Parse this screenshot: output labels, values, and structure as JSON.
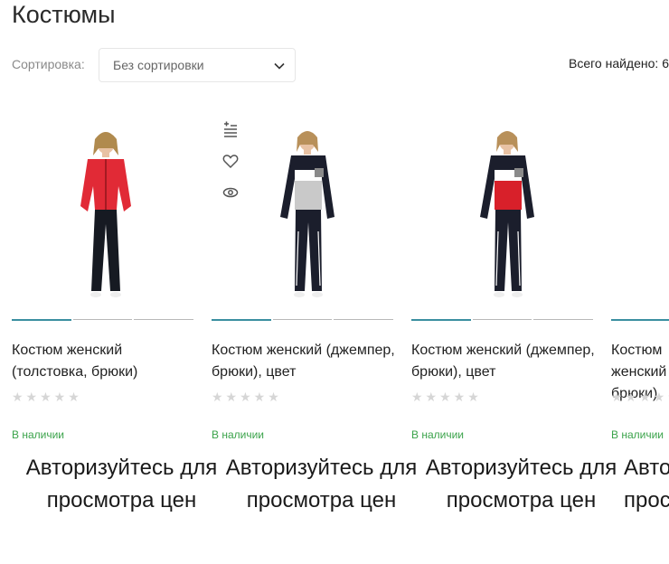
{
  "page": {
    "title": "Костюмы"
  },
  "toolbar": {
    "sort_label": "Сортировка:",
    "sort_value": "Без сортировки",
    "found_label": "Всего найдено:",
    "found_count": "6"
  },
  "colors": {
    "accent": "#3a8fa0",
    "stock_green": "#3aa34a"
  },
  "products": [
    {
      "name": "Костюм женский (толстовка, брюки)",
      "rating": 0,
      "stock": "В наличии",
      "price_note": "Авторизуйтесь для просмотра цен",
      "top_color": "#e12a36",
      "pants_color": "#161a22"
    },
    {
      "name": "Костюм женский (джемпер, брюки), цвет",
      "rating": 0,
      "stock": "В наличии",
      "price_note": "Авторизуйтесь для просмотра цен",
      "top_color": "#c9c9c9",
      "pants_color": "#1b1e2c",
      "icons": [
        "compare-icon",
        "heart-icon",
        "eye-icon"
      ]
    },
    {
      "name": "Костюм женский (джемпер, брюки), цвет",
      "rating": 0,
      "stock": "В наличии",
      "price_note": "Авторизуйтесь для просмотра цен",
      "top_color": "#d8202a",
      "pants_color": "#1b1e2c"
    },
    {
      "name": "Костюм женский брюки),",
      "rating": 0,
      "stock": "В наличии",
      "price_note": "Авторизуйтесь для просмотра цен"
    }
  ]
}
